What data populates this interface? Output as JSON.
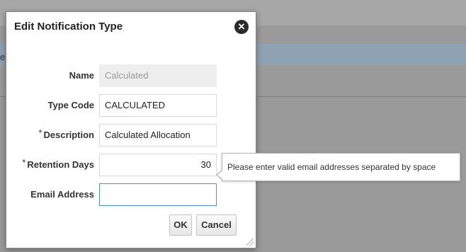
{
  "background": {
    "edge_text": "e"
  },
  "dialog": {
    "title": "Edit Notification Type",
    "close_icon": "close-circle-icon",
    "fields": {
      "name": {
        "label": "Name",
        "value": "Calculated"
      },
      "type_code": {
        "label": "Type Code",
        "value": "CALCULATED"
      },
      "description": {
        "label": "Description",
        "required_mark": "*",
        "value": "Calculated Allocation"
      },
      "retention_days": {
        "label": "Retention Days",
        "required_mark": "*",
        "value": "30"
      },
      "email_address": {
        "label": "Email Address",
        "value": ""
      }
    },
    "tooltip": "Please enter valid email addresses separated by space",
    "buttons": {
      "ok": "OK",
      "cancel": "Cancel"
    }
  },
  "colors": {
    "focus_border": "#4a8fd8",
    "overlay": "#9a9a9a"
  }
}
